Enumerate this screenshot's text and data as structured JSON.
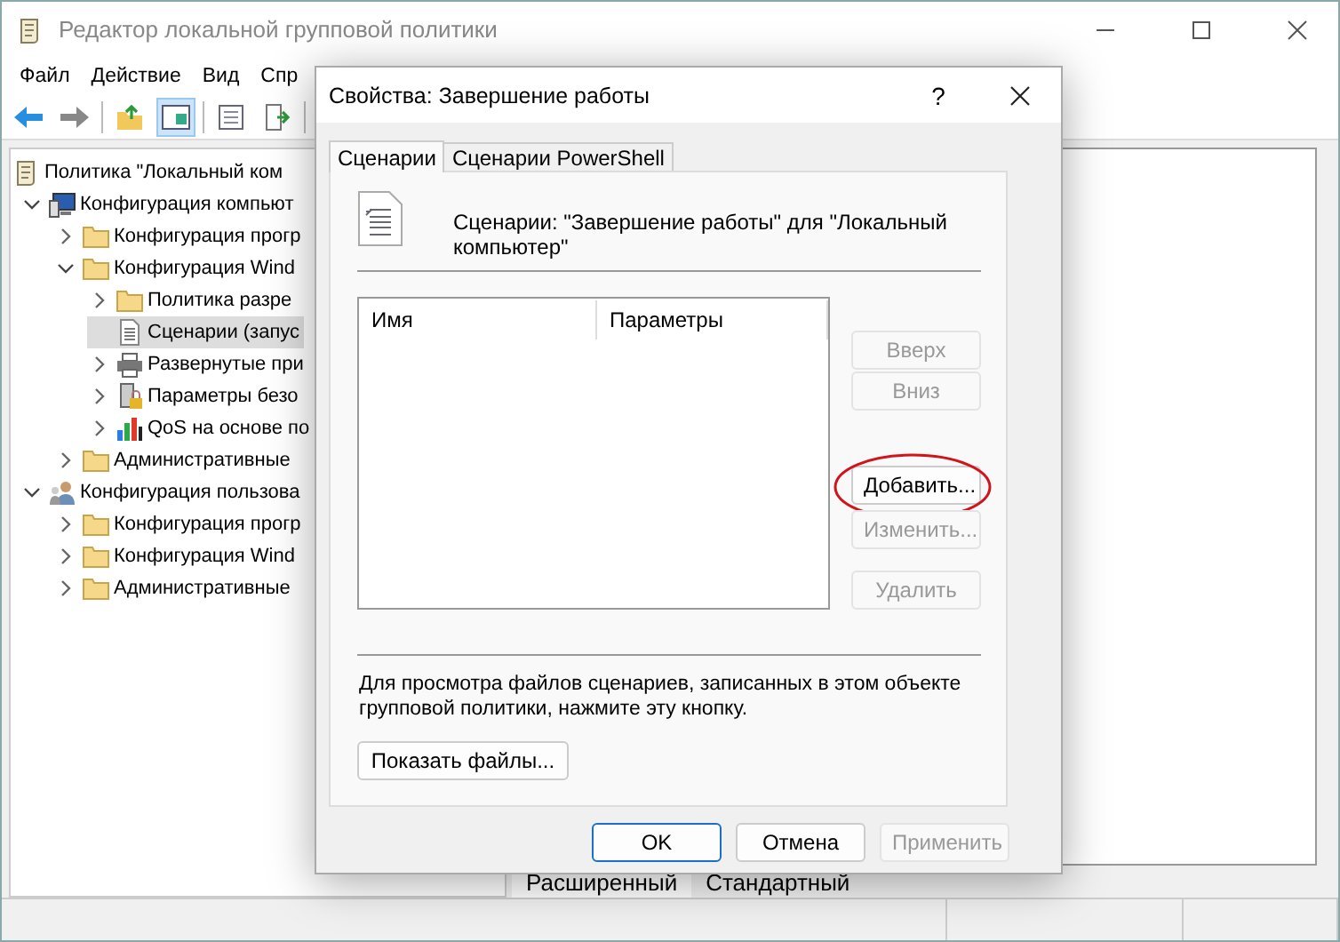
{
  "window": {
    "title": "Редактор локальной групповой политики"
  },
  "menu": [
    "Файл",
    "Действие",
    "Вид",
    "Спр"
  ],
  "tree": {
    "items": [
      {
        "label": "Политика \"Локальный ком",
        "kind": "policy",
        "selected": false
      },
      {
        "label": "Конфигурация компьют",
        "kind": "computer",
        "selected": false,
        "expanded": true,
        "children": [
          {
            "label": "Конфигурация прогр",
            "kind": "folder",
            "selected": false,
            "expanded": false
          },
          {
            "label": "Конфигурация Wind",
            "kind": "folder",
            "selected": false,
            "expanded": true,
            "children": [
              {
                "label": "Политика разре",
                "kind": "folder",
                "selected": false,
                "expanded": false
              },
              {
                "label": "Сценарии (запус",
                "kind": "script",
                "selected": true
              },
              {
                "label": "Развернутые при",
                "kind": "printer",
                "selected": false,
                "expanded": false
              },
              {
                "label": "Параметры безо",
                "kind": "security",
                "selected": false,
                "expanded": false
              },
              {
                "label": "QoS на основе по",
                "kind": "chart",
                "selected": false,
                "expanded": false
              }
            ]
          },
          {
            "label": "Административные",
            "kind": "folder",
            "selected": false,
            "expanded": false
          }
        ]
      },
      {
        "label": "Конфигурация пользова",
        "kind": "user",
        "selected": false,
        "expanded": true,
        "children": [
          {
            "label": "Конфигурация прогр",
            "kind": "folder",
            "selected": false,
            "expanded": false
          },
          {
            "label": "Конфигурация Wind",
            "kind": "folder",
            "selected": false,
            "expanded": false
          },
          {
            "label": "Административные",
            "kind": "folder",
            "selected": false,
            "expanded": false
          }
        ]
      }
    ]
  },
  "view_tabs": [
    {
      "label": "Расширенный",
      "selected": true
    },
    {
      "label": "Стандартный",
      "selected": false
    }
  ],
  "dialog": {
    "title": "Свойства: Завершение работы",
    "help": "?",
    "tabs": [
      {
        "label": "Сценарии",
        "selected": true
      },
      {
        "label": "Сценарии PowerShell",
        "selected": false
      }
    ],
    "heading": "Сценарии: \"Завершение работы\" для \"Локальный компьютер\"",
    "list": {
      "columns": [
        "Имя",
        "Параметры"
      ]
    },
    "side_buttons": [
      {
        "label": "Вверх",
        "disabled": true,
        "circled": false
      },
      {
        "label": "Вниз",
        "disabled": true,
        "circled": false
      },
      {
        "label": "Добавить...",
        "disabled": false,
        "circled": true
      },
      {
        "label": "Изменить...",
        "disabled": true,
        "circled": false
      },
      {
        "label": "Удалить",
        "disabled": true,
        "circled": false
      }
    ],
    "note": "Для просмотра файлов сценариев, записанных в этом объекте групповой политики, нажмите эту кнопку.",
    "show_files_button": "Показать файлы...",
    "buttons": [
      {
        "label": "OK",
        "disabled": false,
        "default": true
      },
      {
        "label": "Отмена",
        "disabled": false,
        "default": false
      },
      {
        "label": "Применить",
        "disabled": true,
        "default": false
      }
    ]
  }
}
